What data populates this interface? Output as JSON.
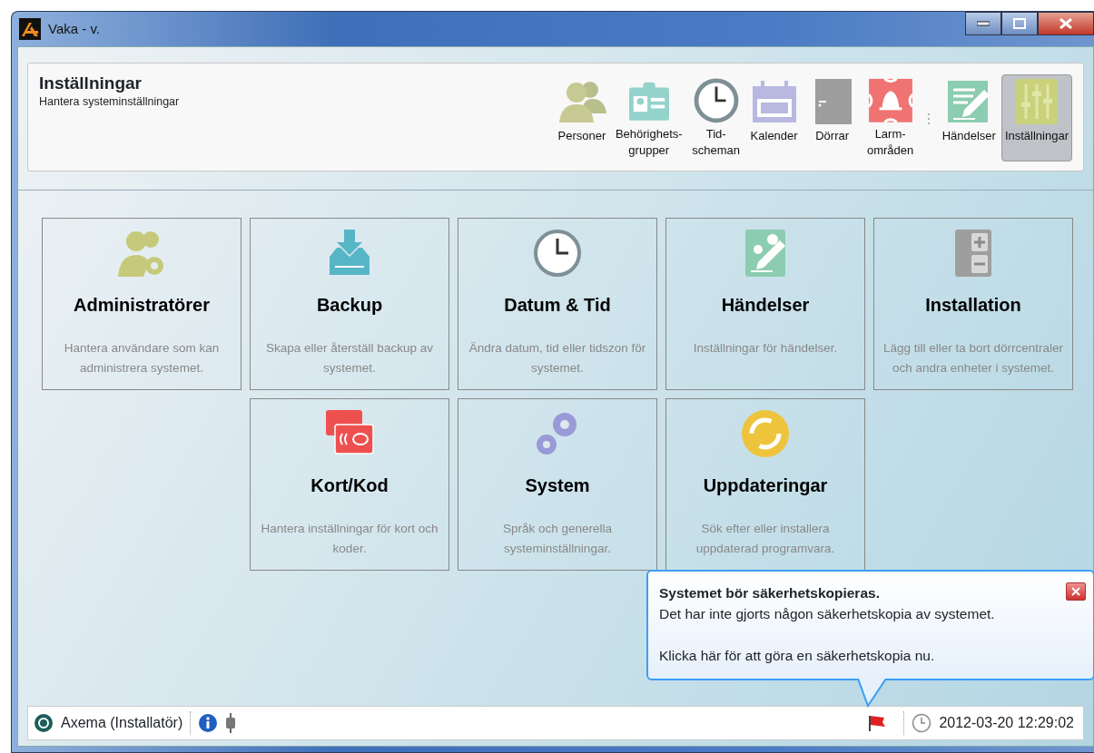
{
  "window": {
    "title": "Vaka - v."
  },
  "header": {
    "title": "Inställningar",
    "subtitle": "Hantera systeminställningar"
  },
  "toolbar": {
    "items": [
      {
        "label": "Personer",
        "selected": false
      },
      {
        "label": "Behörighets-\ngrupper",
        "selected": false
      },
      {
        "label": "Tid-\nscheman",
        "selected": false
      },
      {
        "label": "Kalender",
        "selected": false
      },
      {
        "label": "Dörrar",
        "selected": false
      },
      {
        "label": "Larm-\nområden",
        "selected": false
      },
      {
        "label": "Händelser",
        "selected": false
      },
      {
        "label": "Inställningar",
        "selected": true
      }
    ]
  },
  "tiles": [
    {
      "title": "Administratörer",
      "description": "Hantera användare som kan administrera systemet."
    },
    {
      "title": "Backup",
      "description": "Skapa eller återställ backup av systemet."
    },
    {
      "title": "Datum & Tid",
      "description": "Ändra datum, tid eller tidszon för systemet."
    },
    {
      "title": "Händelser",
      "description": "Inställningar för händelser."
    },
    {
      "title": "Installation",
      "description": "Lägg till eller ta bort dörrcentraler och andra enheter i systemet."
    },
    {
      "title": "Kort/Kod",
      "description": "Hantera inställningar för kort och koder."
    },
    {
      "title": "System",
      "description": "Språk och generella systeminställningar."
    },
    {
      "title": "Uppdateringar",
      "description": "Sök efter eller installera uppdaterad programvara."
    }
  ],
  "notification": {
    "title": "Systemet bör säkerhetskopieras.",
    "message": "Det har inte gjorts någon säkerhetskopia av systemet.",
    "link": "Klicka här för att göra en säkerhetskopia nu."
  },
  "status_bar": {
    "user": "Axema (Installatör)",
    "datetime": "2012-03-20 12:29:02"
  }
}
